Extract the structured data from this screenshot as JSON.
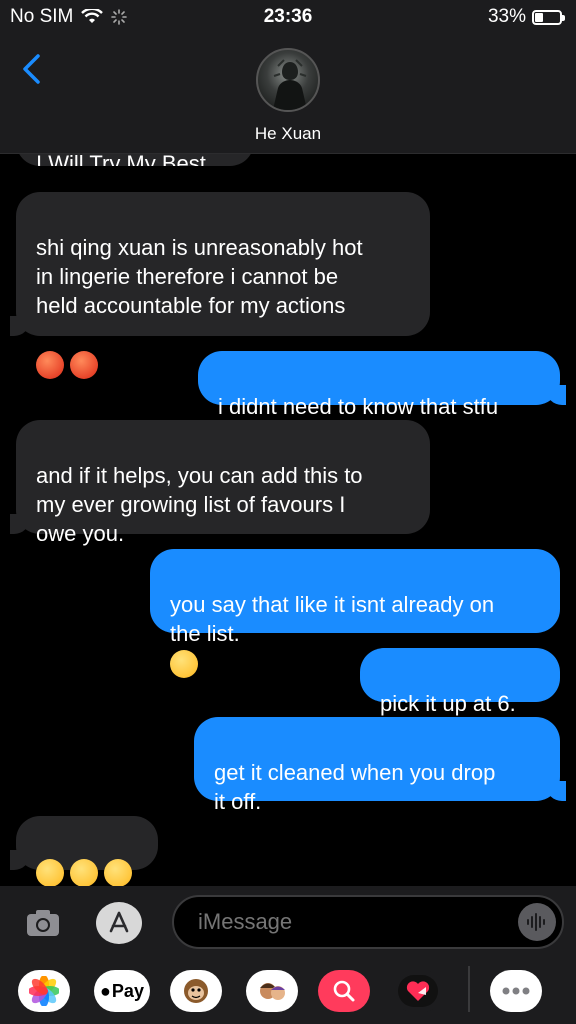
{
  "status_bar": {
    "carrier": "No SIM",
    "time": "23:36",
    "battery_percent": "33%",
    "battery_level": 0.33
  },
  "header": {
    "contact_name": "He Xuan"
  },
  "messages": [
    {
      "from": "in",
      "text": "I Will Try My Best."
    },
    {
      "from": "in",
      "text": "shi qing xuan is unreasonably hot\nin lingerie therefore i cannot be\nheld accountable for my actions",
      "emoji": [
        "hot-face",
        "hot-face"
      ]
    },
    {
      "from": "out",
      "text": "i didnt need to know that stfu"
    },
    {
      "from": "in",
      "text": "and if it helps, you can add this to\nmy ever growing list of favours I\nowe you."
    },
    {
      "from": "out",
      "text": "you say that like it isnt already on\nthe list.",
      "emoji": [
        "unamused-face"
      ]
    },
    {
      "from": "out",
      "text": "pick it up at 6."
    },
    {
      "from": "out",
      "text": "get it cleaned when you drop\nit off."
    },
    {
      "from": "in",
      "text": "",
      "emoji": [
        "star-struck",
        "star-struck",
        "star-struck"
      ]
    }
  ],
  "input": {
    "placeholder": "iMessage"
  },
  "app_drawer": {
    "pay_label": "Pay",
    "icons": [
      "photos-icon",
      "apple-pay-icon",
      "animoji-icon",
      "memoji-icon",
      "image-search-icon",
      "digital-touch-icon",
      "more-icon"
    ]
  },
  "colors": {
    "outgoing": "#1a8cff",
    "incoming": "#262628",
    "background": "#000000"
  }
}
